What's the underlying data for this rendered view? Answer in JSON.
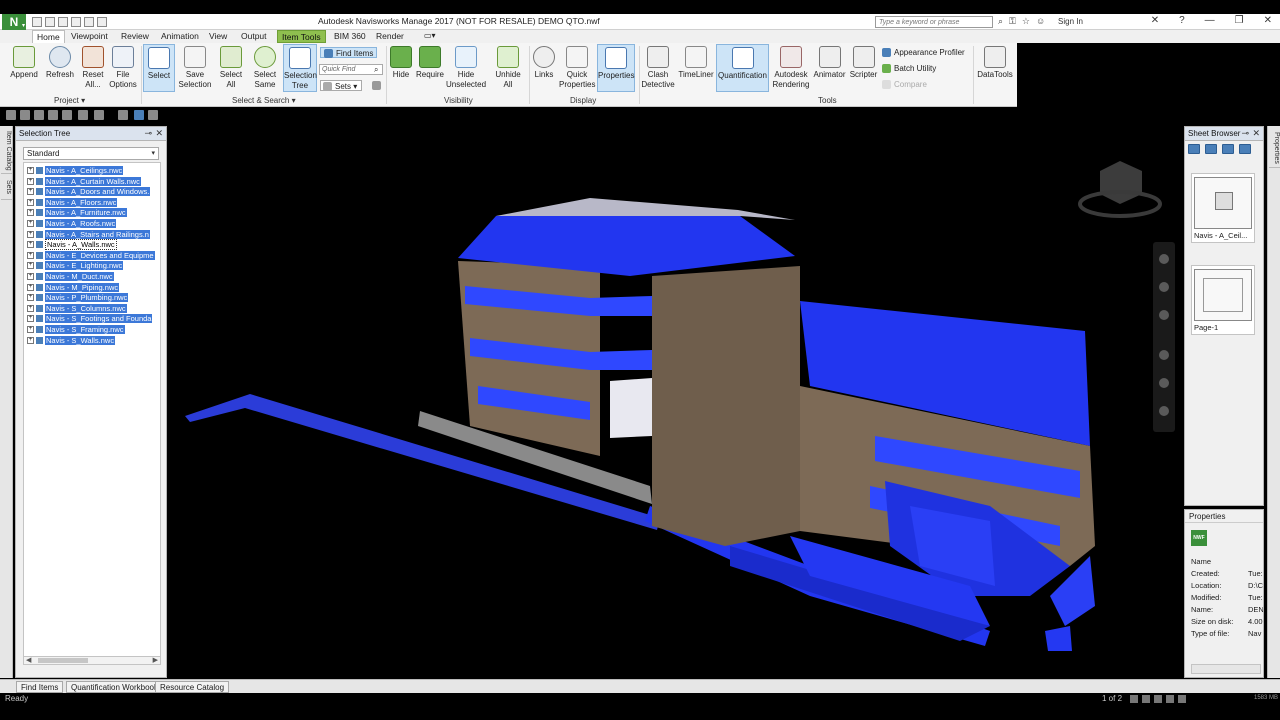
{
  "titlebar": {
    "title": "Autodesk Navisworks Manage 2017 (NOT FOR RESALE)    DEMO QTO.nwf",
    "logo_letter": "N",
    "search_placeholder": "Type a keyword or phrase",
    "sign_in": "Sign In"
  },
  "tabs": [
    "Home",
    "Viewpoint",
    "Review",
    "Animation",
    "View",
    "Output",
    "Item Tools",
    "BIM 360",
    "Render"
  ],
  "ribbon": {
    "project": {
      "label": "Project",
      "buttons": [
        "Append",
        "Refresh",
        "Reset\nAll...",
        "File\nOptions"
      ]
    },
    "select_search": {
      "label": "Select & Search",
      "buttons": [
        "Select",
        "Save\nSelection",
        "Select\nAll",
        "Select\nSame",
        "Selection\nTree"
      ],
      "find_items": "Find Items",
      "quick_find": "Quick Find",
      "sets": "Sets"
    },
    "visibility": {
      "label": "Visibility",
      "buttons": [
        "Hide",
        "Require",
        "Hide\nUnselected",
        "Unhide\nAll"
      ]
    },
    "display": {
      "label": "Display",
      "buttons": [
        "Links",
        "Quick\nProperties",
        "Properties"
      ]
    },
    "tools": {
      "label": "Tools",
      "buttons": [
        "Clash\nDetective",
        "TimeLiner",
        "Quantification",
        "Autodesk\nRendering",
        "Animator",
        "Scripter"
      ],
      "small": [
        "Appearance Profiler",
        "Batch Utility",
        "Compare"
      ],
      "datatools": "DataTools"
    }
  },
  "side_left_tabs": [
    "Item Catalog",
    "Sets"
  ],
  "selection_tree": {
    "title": "Selection Tree",
    "dropdown": "Standard",
    "items": [
      {
        "label": "Navis - A_Ceilings.nwc",
        "selected": true
      },
      {
        "label": "Navis - A_Curtain Walls.nwc",
        "selected": true
      },
      {
        "label": "Navis - A_Doors and Windows.",
        "selected": true
      },
      {
        "label": "Navis - A_Floors.nwc",
        "selected": true
      },
      {
        "label": "Navis - A_Furniture.nwc",
        "selected": true
      },
      {
        "label": "Navis - A_Roofs.nwc",
        "selected": true
      },
      {
        "label": "Navis - A_Stairs and Railings.n",
        "selected": true
      },
      {
        "label": "Navis - A_Walls.nwc",
        "selected": false
      },
      {
        "label": "Navis - E_Devices and Equipme",
        "selected": true
      },
      {
        "label": "Navis - E_Lighting.nwc",
        "selected": true
      },
      {
        "label": "Navis - M_Duct.nwc",
        "selected": true
      },
      {
        "label": "Navis - M_Piping.nwc",
        "selected": true
      },
      {
        "label": "Navis - P_Plumbing.nwc",
        "selected": true
      },
      {
        "label": "Navis - S_Columns.nwc",
        "selected": true
      },
      {
        "label": "Navis - S_Footings and Founda",
        "selected": true
      },
      {
        "label": "Navis - S_Framing.nwc",
        "selected": true
      },
      {
        "label": "Navis - S_Walls.nwc",
        "selected": true
      }
    ]
  },
  "sheet_browser": {
    "title": "Sheet Browser",
    "sheets": [
      "Navis - A_Ceil...",
      "Page-1"
    ]
  },
  "properties": {
    "title": "Properties",
    "badge": "NWF",
    "header": "Name",
    "rows": [
      {
        "key": "Created:",
        "value": "Tue:"
      },
      {
        "key": "Location:",
        "value": "D:\\C"
      },
      {
        "key": "Modified:",
        "value": "Tue:"
      },
      {
        "key": "Name:",
        "value": "DEN"
      },
      {
        "key": "Size on disk:",
        "value": "4.00"
      },
      {
        "key": "Type of file:",
        "value": "Nav"
      }
    ]
  },
  "side_right_tabs": [
    "Properties"
  ],
  "bottom_tabs": [
    "Find Items",
    "Quantification Workbook",
    "Resource Catalog"
  ],
  "status": {
    "text": "Ready",
    "page": "1 of 2",
    "memory": "1583 MB"
  },
  "colors": {
    "selection_blue": "#3c78d8",
    "model_blue": "#2d44ff",
    "wall_tan": "#7d6a56",
    "context_tab": "#8fbf4f"
  }
}
